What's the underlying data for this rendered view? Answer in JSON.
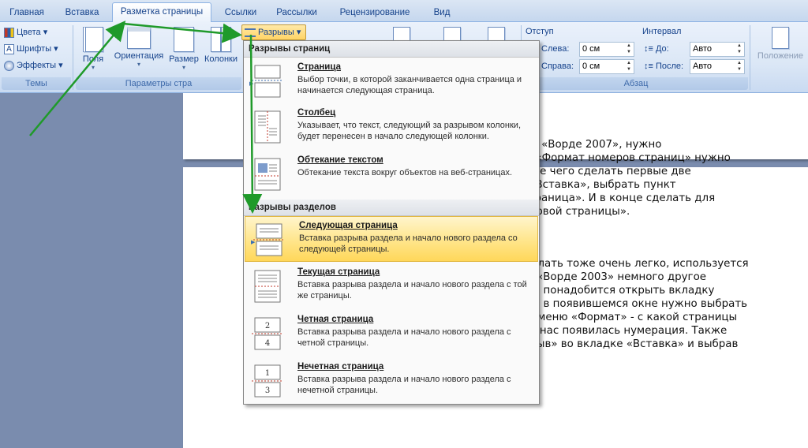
{
  "tabs": [
    "Главная",
    "Вставка",
    "Разметка страницы",
    "Ссылки",
    "Рассылки",
    "Рецензирование",
    "Вид"
  ],
  "ribbon": {
    "themes": {
      "colors": "Цвета",
      "fonts": "Шрифты",
      "effects": "Эффекты",
      "group_label": "Темы"
    },
    "page_setup": {
      "margins": "Поля",
      "orientation": "Ориентация",
      "size": "Размер",
      "columns": "Колонки",
      "breaks": "Разрывы",
      "group_label": "Параметры стра"
    },
    "paragraph": {
      "indent_header": "Отступ",
      "spacing_header": "Интервал",
      "left_label": "Слева:",
      "left_value": "0 см",
      "right_label": "Справа:",
      "right_value": "0 см",
      "before_label": "До:",
      "before_value": "Авто",
      "after_label": "После:",
      "after_value": "Авто",
      "group_label": "Абзац"
    },
    "arrange": {
      "position": "Положение"
    }
  },
  "menu": {
    "page_breaks_header": "Разрывы страниц",
    "section_breaks_header": "Разрывы разделов",
    "items": [
      {
        "title": "Страница",
        "desc": "Выбор точки, в которой заканчивается одна страница и начинается следующая страница."
      },
      {
        "title": "Столбец",
        "desc": "Указывает, что текст, следующий за разрывом колонки, будет перенесен в начало следующей колонки."
      },
      {
        "title": "Обтекание текстом",
        "desc": "Обтекание текста вокруг объектов на веб-страницах."
      },
      {
        "title": "Следующая страница",
        "desc": "Вставка разрыва раздела и начало нового раздела со следующей страницы."
      },
      {
        "title": "Текущая страница",
        "desc": "Вставка разрыва раздела и начало нового раздела с той же страницы."
      },
      {
        "title": "Четная страница",
        "desc": "Вставка разрыва раздела и начало нового раздела с четной страницы."
      },
      {
        "title": "Нечетная страница",
        "desc": "Вставка разрыва раздела и начало нового раздела с нечетной страницы."
      }
    ]
  },
  "document": {
    "para1": [
      "цы в «Ворде 2007», нужно",
      "кте «Формат номеров страниц» нужно",
      "После чего сделать первые две",
      "ку «Вставка», выбрать пункт",
      "я страница». И в конце сделать для",
      "я первой страницы»."
    ],
    "para2": [
      "делать тоже очень легко, используется",
      "«Ворде 2003» немного другое",
      ". понадобится открыть вкладку",
      ", в появившемся окне нужно выбрать",
      "положение и выравнивание номера, а также в меню «Формат» - с какой страницы",
      "начинать нумерацию. Далее нажиавем «Ок», у нас появилась нумерация. Также",
      "создаем новые разделы, нажав на пункт «Разрыв» во вкладке «Вставка» и выбрав"
    ]
  },
  "colors": {
    "ribbon_text": "#15428b",
    "arrow": "#1f9a2a",
    "hover_item": "#ffe58a",
    "doc_background": "#7a8cae"
  }
}
